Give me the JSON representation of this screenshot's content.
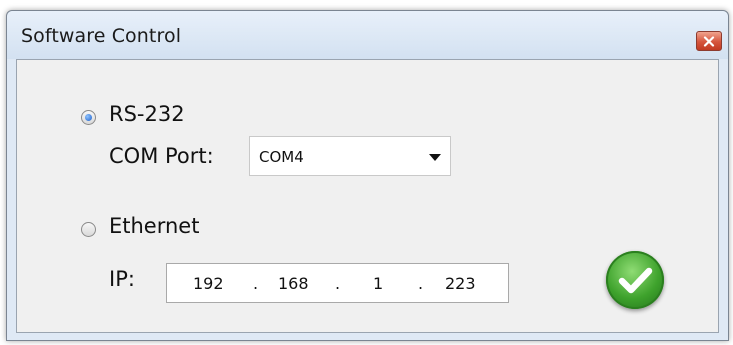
{
  "window": {
    "title": "Software Control",
    "close_icon": "close-icon"
  },
  "rs232": {
    "label": "RS-232",
    "selected": true
  },
  "com_port": {
    "label": "COM Port:",
    "value": "COM4"
  },
  "ethernet": {
    "label": "Ethernet",
    "selected": false
  },
  "ip": {
    "label": "IP:",
    "octets": [
      "192",
      "168",
      "1",
      "223"
    ],
    "separator": "."
  },
  "ok_button": {
    "icon": "checkmark-icon"
  },
  "colors": {
    "ok_green": "#3ea22c",
    "close_red": "#d5553d",
    "radio_blue": "#1d5fc8"
  }
}
